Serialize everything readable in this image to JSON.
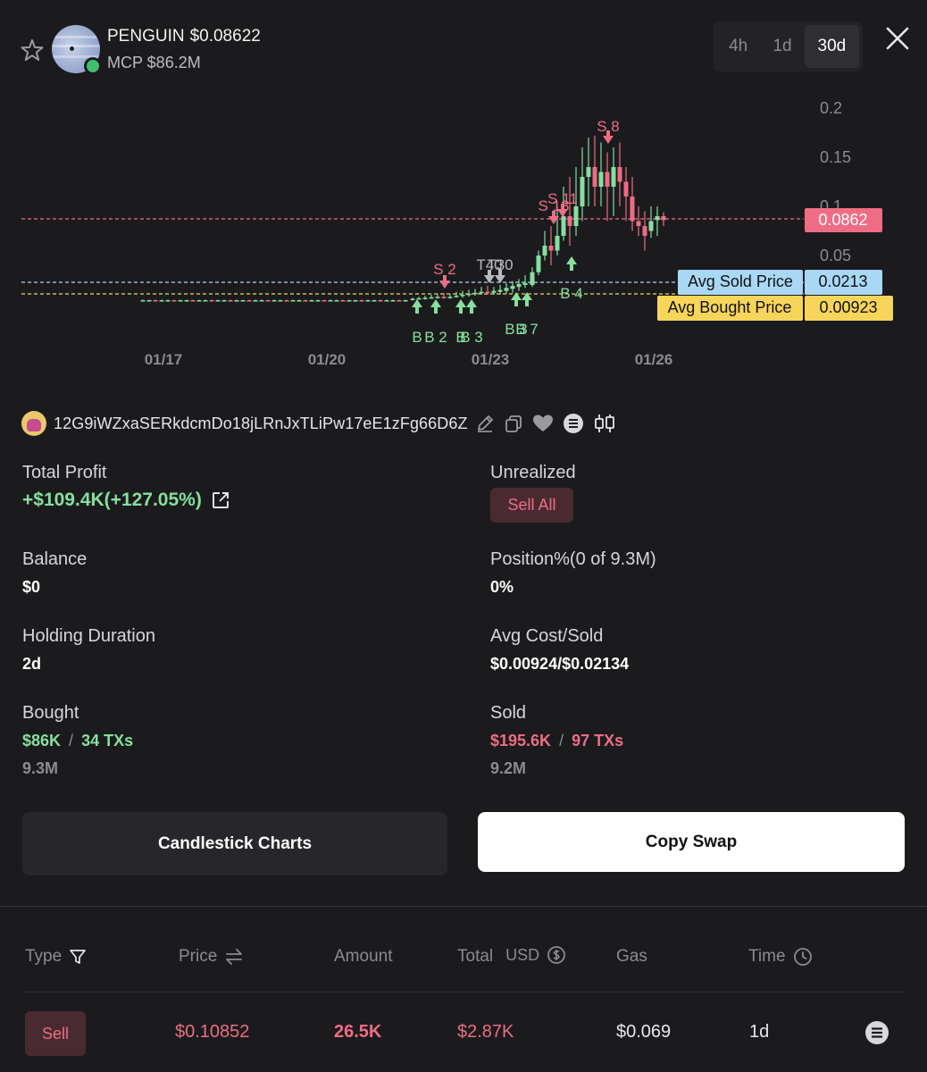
{
  "header": {
    "token_name": "PENGUIN",
    "token_price": "$0.08622",
    "mcp": "MCP $86.2M",
    "timeframes": [
      "4h",
      "1d",
      "30d"
    ],
    "active_timeframe": "30d"
  },
  "chart_data": {
    "type": "candlestick",
    "x_tick_labels": [
      "01/17",
      "01/20",
      "01/23",
      "01/26"
    ],
    "y_tick_labels": [
      "0.2",
      "0.15",
      "0.1",
      "0.05"
    ],
    "ylim": [
      0,
      0.22
    ],
    "current_price_label": "0.0862",
    "avg_sold_label": "Avg Sold Price",
    "avg_sold_value": "0.0213",
    "avg_bought_label": "Avg Bought Price",
    "avg_bought_value": "0.00923",
    "price_lines": {
      "current": 0.0862,
      "avg_sold": 0.0213,
      "avg_bought": 0.00923
    },
    "trade_markers": [
      {
        "label": "S 8",
        "kind": "sell",
        "date": "01/25",
        "value": 0.155
      },
      {
        "label": "S 11",
        "kind": "sell",
        "date": "01/24",
        "value": 0.095
      },
      {
        "label": "S 13",
        "kind": "sell",
        "date": "01/24",
        "value": 0.086
      },
      {
        "label": "S 2",
        "kind": "sell",
        "date": "01/22",
        "value": 0.018
      },
      {
        "label": "T40",
        "kind": "transfer",
        "date": "01/23",
        "value": 0.018
      },
      {
        "label": "T30",
        "kind": "transfer",
        "date": "01/23",
        "value": 0.018
      },
      {
        "label": "B 4",
        "kind": "buy",
        "date": "01/24",
        "value": 0.03
      },
      {
        "label": "B 7",
        "kind": "buy",
        "date": "01/23",
        "value": 0.01
      },
      {
        "label": "B 3",
        "kind": "buy",
        "date": "01/23",
        "value": 0.009
      },
      {
        "label": "B 2",
        "kind": "buy",
        "date": "01/22",
        "value": 0.006
      },
      {
        "label": "B 3",
        "kind": "buy",
        "date": "01/22",
        "value": 0.006
      },
      {
        "label": "B",
        "kind": "buy",
        "date": "01/22",
        "value": 0.006
      },
      {
        "label": "B",
        "kind": "buy",
        "date": "01/21",
        "value": 0.005
      }
    ]
  },
  "wallet": {
    "address": "12G9iWZxaSERkdcmDo18jLRnJxTLiPw17eE1zFg66D6Z"
  },
  "stats": {
    "total_profit_label": "Total Profit",
    "total_profit_value": "+$109.4K(+127.05%)",
    "unrealized_label": "Unrealized",
    "sell_all": "Sell All",
    "balance_label": "Balance",
    "balance_value": "$0",
    "position_label": "Position%(0 of 9.3M)",
    "position_value": "0%",
    "holding_label": "Holding Duration",
    "holding_value": "2d",
    "avg_cost_label": "Avg Cost/Sold",
    "avg_cost_value": "$0.00924/$0.02134",
    "bought_label": "Bought",
    "bought_usd": "$86K",
    "bought_txs": "34 TXs",
    "bought_amount": "9.3M",
    "sold_label": "Sold",
    "sold_usd": "$195.6K",
    "sold_txs": "97 TXs",
    "sold_amount": "9.2M",
    "separator": "/"
  },
  "actions": {
    "candlestick": "Candlestick Charts",
    "copy_swap": "Copy Swap"
  },
  "table": {
    "headers": {
      "type": "Type",
      "price": "Price",
      "amount": "Amount",
      "total": "Total",
      "usd": "USD",
      "gas": "Gas",
      "time": "Time"
    },
    "rows": [
      {
        "type": "Sell",
        "price": "$0.10852",
        "amount": "26.5K",
        "total": "$2.87K",
        "gas": "$0.069",
        "time": "1d"
      }
    ]
  },
  "colors": {
    "up": "#86df9d",
    "down": "#ee6d84",
    "avg_sold_bg": "#a9d8f5",
    "avg_bought_bg": "#f7d55a",
    "background": "#1b1b1e"
  }
}
